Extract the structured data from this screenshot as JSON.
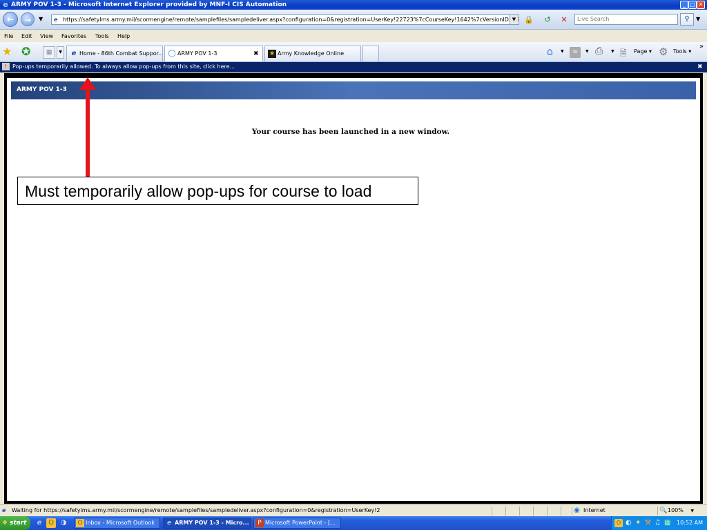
{
  "window": {
    "title": "ARMY POV 1-3 - Microsoft Internet Explorer provided by MNF-I CIS Automation",
    "minimize": "_",
    "maximize": "□",
    "close": "✕"
  },
  "address": {
    "url": "https://safetylms.army.mil/scormengine/remote/samplefiles/sampledeliver.aspx?configuration=0&registration=UserKey!22723%7cCourseKey!1642%7cVersionID!0%7c",
    "search_placeholder": "Live Search"
  },
  "menu": [
    "File",
    "Edit",
    "View",
    "Favorites",
    "Tools",
    "Help"
  ],
  "tabs": [
    {
      "label": "Home - 86th Combat Suppor...",
      "icon": "ie-icon"
    },
    {
      "label": "ARMY POV 1-3",
      "icon": "loading-icon",
      "close": "✖"
    },
    {
      "label": "Army Knowledge Online",
      "icon": "army-star-icon"
    }
  ],
  "command_bar": {
    "page": "Page",
    "tools": "Tools",
    "chevron": "»"
  },
  "infobar": {
    "text": "Pop-ups temporarily allowed. To always allow pop-ups from this site, click here...",
    "close": "✖"
  },
  "content": {
    "course_title": "ARMY POV 1-3",
    "message": "Your course has been launched in a new window."
  },
  "annotation": {
    "callout": "Must temporarily allow pop-ups for course to load",
    "arrow_color": "#e3141a"
  },
  "status": {
    "text": "Waiting for https://safetylms.army.mil/scormengine/remote/samplefiles/sampledeliver.aspx?configuration=0&registration=UserKey!2",
    "zone": "Internet",
    "zoom": "100%"
  },
  "taskbar": {
    "start": "start",
    "tasks": [
      {
        "label": "Inbox - Microsoft Outlook",
        "icon": "outlook-icon"
      },
      {
        "label": "ARMY POV 1-3 - Micro...",
        "icon": "ie-icon"
      },
      {
        "label": "Microsoft PowerPoint - [...",
        "icon": "powerpoint-icon"
      }
    ],
    "clock": "10:52 AM"
  },
  "colors": {
    "titlebar": "#0a3cc2",
    "infobar": "#0a246a",
    "taskbar": "#245edb",
    "arrow": "#e3141a"
  }
}
